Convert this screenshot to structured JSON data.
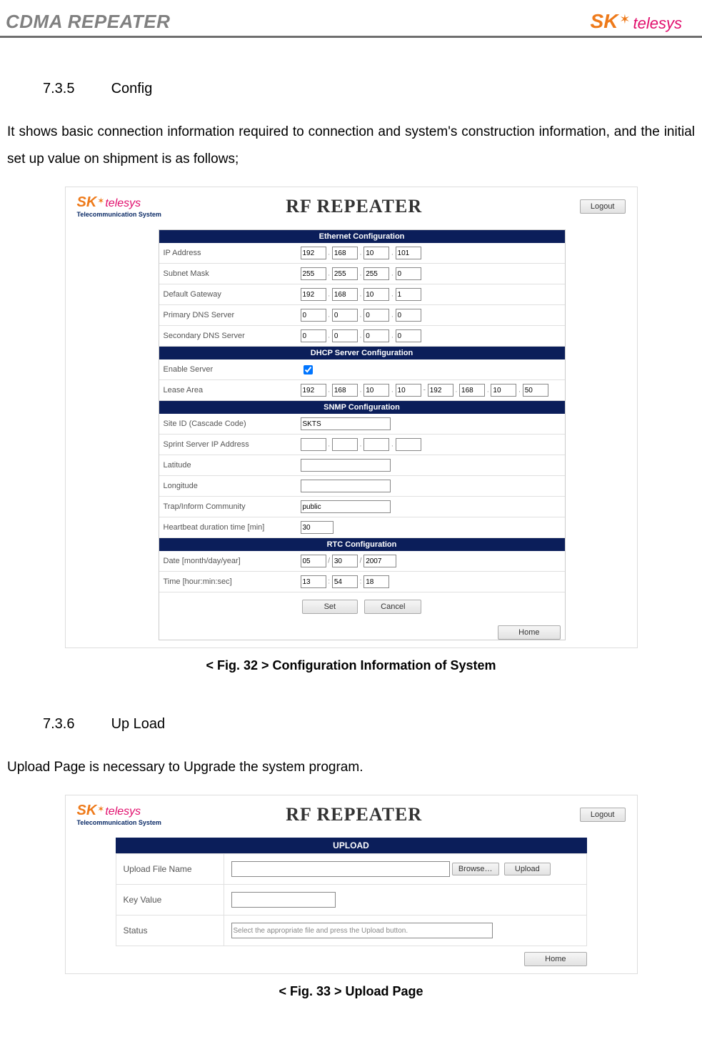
{
  "header": {
    "doc_title": "CDMA REPEATER",
    "logo_sk": "SK",
    "logo_telesys": "telesys"
  },
  "section1": {
    "number": "7.3.5",
    "title": "Config",
    "body": "It shows basic connection information required to connection and system's construction information, and the initial set up value on shipment is as follows;",
    "caption": "< Fig. 32 > Configuration Information of System"
  },
  "section2": {
    "number": "7.3.6",
    "title": "Up Load",
    "body": "Upload Page is necessary to Upgrade the system program.",
    "caption": "< Fig. 33 > Upload Page"
  },
  "embed_common": {
    "logo_sk": "SK",
    "logo_telesys": "telesys",
    "logo_sub": "Telecommunication System",
    "app_title": "RF REPEATER",
    "logout": "Logout",
    "home": "Home",
    "set": "Set",
    "cancel": "Cancel"
  },
  "fig32": {
    "bar_eth": "Ethernet Configuration",
    "bar_dhcp": "DHCP Server Configuration",
    "bar_snmp": "SNMP Configuration",
    "bar_rtc": "RTC Configuration",
    "rows": {
      "ip_label": "IP Address",
      "ip": [
        "192",
        "168",
        "10",
        "101"
      ],
      "subnet_label": "Subnet Mask",
      "subnet": [
        "255",
        "255",
        "255",
        "0"
      ],
      "gateway_label": "Default Gateway",
      "gateway": [
        "192",
        "168",
        "10",
        "1"
      ],
      "pdns_label": "Primary DNS Server",
      "pdns": [
        "0",
        "0",
        "0",
        "0"
      ],
      "sdns_label": "Secondary DNS Server",
      "sdns": [
        "0",
        "0",
        "0",
        "0"
      ],
      "enable_label": "Enable Server",
      "lease_label": "Lease Area",
      "lease_a": [
        "192",
        "168",
        "10",
        "10"
      ],
      "lease_b": [
        "192",
        "168",
        "10",
        "50"
      ],
      "site_label": "Site ID (Cascade Code)",
      "site_val": "SKTS",
      "sprint_label": "Sprint Server IP Address",
      "sprint": [
        "",
        "",
        "",
        ""
      ],
      "lat_label": "Latitude",
      "lat_val": "",
      "lon_label": "Longitude",
      "lon_val": "",
      "trap_label": "Trap/Inform Community",
      "trap_val": "public",
      "hb_label": "Heartbeat duration time [min]",
      "hb_val": "30",
      "date_label": "Date [month/day/year]",
      "date": [
        "05",
        "30",
        "2007"
      ],
      "time_label": "Time [hour:min:sec]",
      "time": [
        "13",
        "54",
        "18"
      ]
    }
  },
  "fig33": {
    "bar": "UPLOAD",
    "upload_name_label": "Upload File Name",
    "browse": "Browse…",
    "upload": "Upload",
    "key_label": "Key Value",
    "status_label": "Status",
    "status_val": "Select the appropriate file and press the Upload button."
  }
}
